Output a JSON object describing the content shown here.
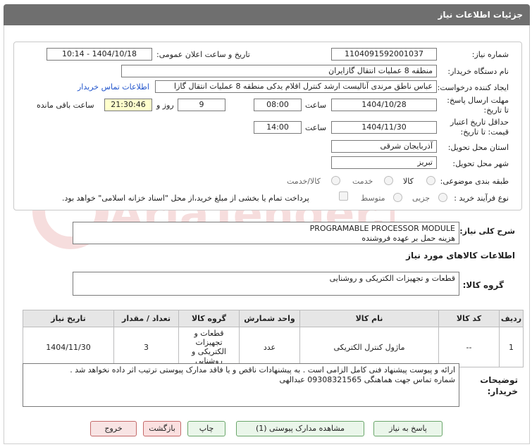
{
  "header": {
    "title": "جزئیات اطلاعات نیاز"
  },
  "form": {
    "need_number_label": "شماره نیاز:",
    "need_number": "1104091592001037",
    "announce_label": "تاریخ و ساعت اعلان عمومی:",
    "announce_value": "1404/10/18 - 10:14",
    "buyer_org_label": "نام دستگاه خریدار:",
    "buyer_org": "منطقه 8 عملیات انتقال گازایران",
    "creator_label": "ایجاد کننده درخواست:",
    "creator": "عباس ناطق مرندی آنالیست ارشد کنترل اقلام یدکی منطقه 8 عملیات انتقال گازا",
    "contact_link": "اطلاعات تماس خریدار",
    "deadline_label": "مهلت ارسال پاسخ: تا تاریخ:",
    "deadline_date": "1404/10/28",
    "time_label": "ساعت",
    "deadline_time": "08:00",
    "days_value": "9",
    "days_and_label": "روز و",
    "remaining_time": "21:30:46",
    "remaining_label": "ساعت باقی مانده",
    "validity_label": "حداقل تاریخ اعتبار قیمت: تا تاریخ:",
    "validity_date": "1404/11/30",
    "validity_time_label": "ساعت",
    "validity_time": "14:00",
    "province_label": "استان محل تحویل:",
    "province": "آذربایجان شرقی",
    "city_label": "شهر محل تحویل:",
    "city": "تبریز",
    "category_label": "طبقه بندی موضوعی:",
    "category_options": [
      "کالا",
      "خدمت",
      "کالا/خدمت"
    ],
    "process_label": "نوع فرآیند خرید :",
    "process_options": [
      "جزیی",
      "متوسط"
    ],
    "payment_note": "پرداخت تمام یا بخشی از مبلغ خرید،از محل \"اسناد خزانه اسلامی\" خواهد بود."
  },
  "summary": {
    "label": "شرح کلی نیاز:",
    "line1": "PROGRAMABLE PROCESSOR MODULE",
    "line2": "هزینه حمل بر عهده فروشنده"
  },
  "goods": {
    "section_title": "اطلاعات کالاهای مورد نیاز",
    "group_label": "گروه کالا:",
    "group_value": "قطعات و تجهیزات الکتریکی و روشنایی"
  },
  "table": {
    "headers": [
      "ردیف",
      "کد کالا",
      "نام کالا",
      "واحد شمارش",
      "گروه کالا",
      "تعداد / مقدار",
      "تاریخ نیاز"
    ],
    "rows": [
      [
        "1",
        "--",
        "ماژول کنترل الکتریکی",
        "عدد",
        "قطعات و تجهیزات الکتریکی و روشنایی",
        "3",
        "1404/11/30"
      ]
    ]
  },
  "notes": {
    "label": "توضیحات خریدار:",
    "line1": "ارائه و پیوست پیشنهاد فنی کامل الزامی است . به پیشنهادات ناقص و یا فاقد مدارک پیوستی ترتیب اثر داده نخواهد شد .",
    "line2": "شماره تماس جهت هماهنگی 09308321565 عبدالهی"
  },
  "buttons": {
    "reply": "پاسخ به نیاز",
    "view_docs": "مشاهده مدارک پیوستی (1)",
    "print": "چاپ",
    "back": "بازگشت",
    "exit": "خروج"
  },
  "watermark": {
    "text": "AriaTender.net"
  }
}
